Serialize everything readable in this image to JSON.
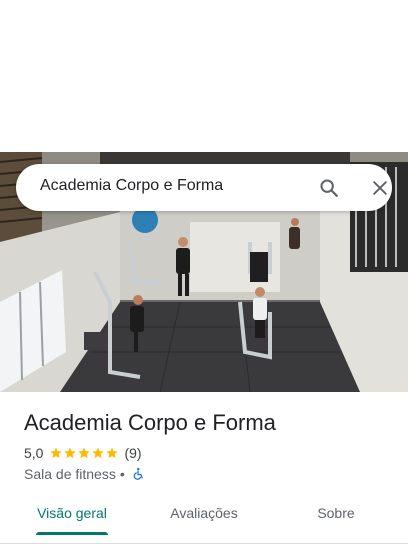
{
  "search": {
    "query": "Academia Corpo e Forma"
  },
  "place": {
    "title": "Academia Corpo e Forma",
    "rating": "5,0",
    "stars_filled": 5,
    "review_count": "(9)",
    "category": "Sala de fitness",
    "separator": "•"
  },
  "tabs": [
    {
      "label": "Visão geral",
      "active": true
    },
    {
      "label": "Avaliações",
      "active": false
    },
    {
      "label": "Sobre",
      "active": false
    }
  ],
  "icons": {
    "search": "search-icon",
    "close": "close-icon",
    "star": "star-icon",
    "accessibility": "wheelchair-icon"
  },
  "colors": {
    "accent": "#00796b",
    "star": "#fbbc04",
    "accessibility": "#1a73e8"
  }
}
